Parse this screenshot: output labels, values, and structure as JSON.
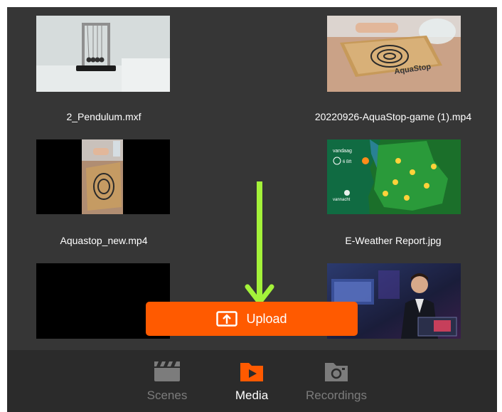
{
  "media": {
    "items": [
      {
        "filename": "2_Pendulum.mxf"
      },
      {
        "filename": "20220926-AquaStop-game (1).mp4"
      },
      {
        "filename": "Aquastop_new.mp4"
      },
      {
        "filename": "E-Weather Report.jpg"
      },
      {
        "filename": ""
      },
      {
        "filename": ""
      }
    ],
    "thumbnail_text": {
      "weather_label": "vandaag",
      "weather_wind": "6 Bft",
      "weather_day": "vannacht",
      "aquastop_brand": "AquaStop"
    }
  },
  "upload": {
    "label": "Upload",
    "icon": "upload-icon"
  },
  "nav": {
    "items": [
      {
        "label": "Scenes",
        "icon": "clapperboard-icon"
      },
      {
        "label": "Media",
        "icon": "media-play-icon"
      },
      {
        "label": "Recordings",
        "icon": "camera-icon"
      }
    ],
    "active": "Media"
  },
  "colors": {
    "background": "#363636",
    "nav_background": "#2b2b2b",
    "accent": "#ff5a00",
    "annotation_arrow": "#a4f23a",
    "inactive_label": "#7c7c7c"
  }
}
